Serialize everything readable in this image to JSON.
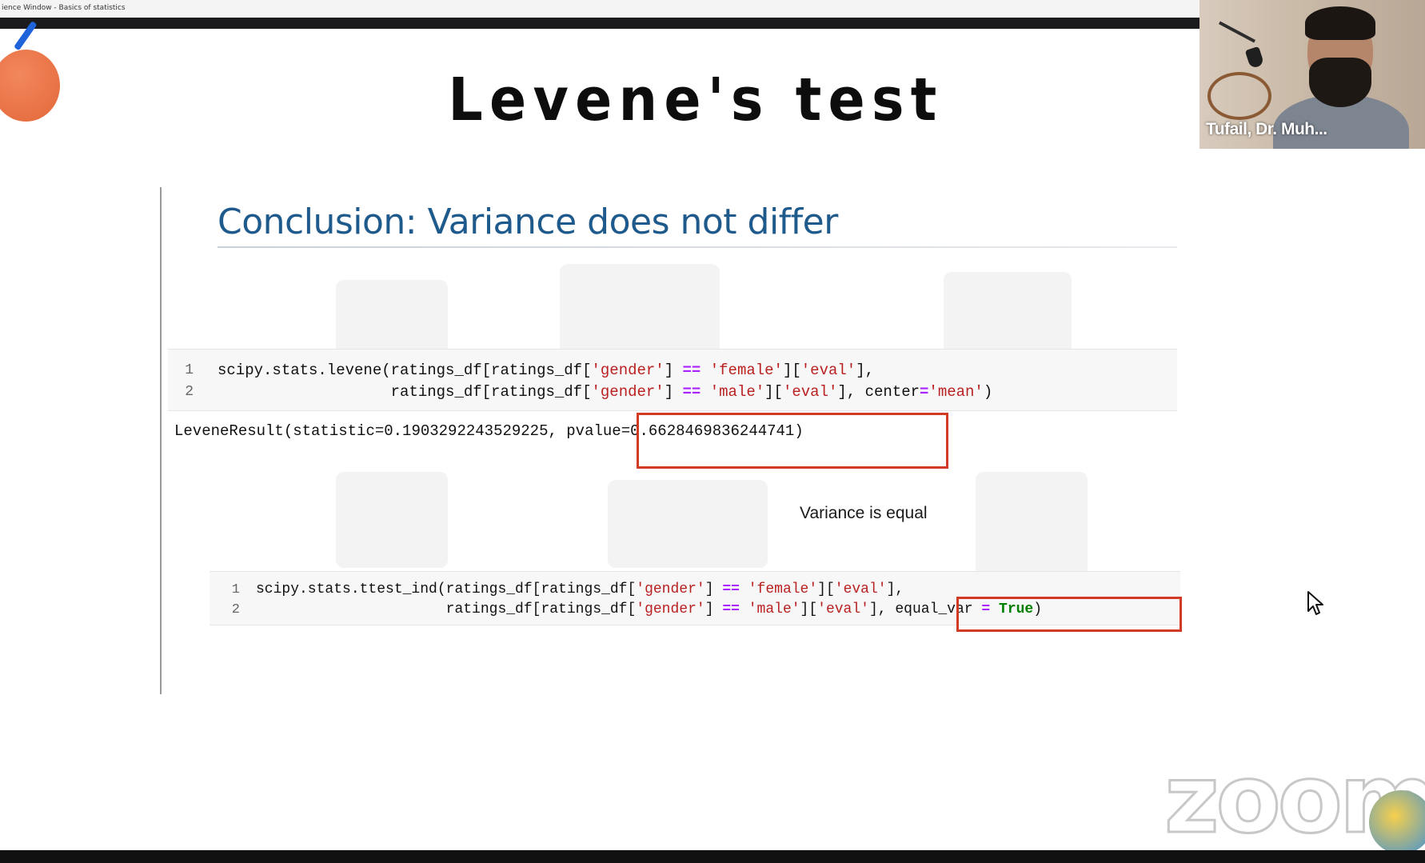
{
  "window": {
    "title": "ience Window - Basics of statistics"
  },
  "slide": {
    "title": "Levene's test",
    "conclusion": "Conclusion: Variance does not differ",
    "note": "Variance is equal"
  },
  "code_block_1": {
    "line_numbers": [
      "1",
      "2"
    ],
    "line1": {
      "a": "scipy.stats.levene(ratings_df[ratings_df[",
      "s1": "'gender'",
      "b": "] ",
      "op": "==",
      "c": " ",
      "s2": "'female'",
      "d": "][",
      "s3": "'eval'",
      "e": "],"
    },
    "line2": {
      "a": "                   ratings_df[ratings_df[",
      "s1": "'gender'",
      "b": "] ",
      "op": "==",
      "c": " ",
      "s2": "'male'",
      "d": "][",
      "s3": "'eval'",
      "e": "], center",
      "op2": "=",
      "s4": "'mean'",
      "f": ")"
    }
  },
  "output": {
    "prefix": "LeveneResult(statistic=0.1903292243529225, ",
    "pvalue": "pvalue=0.6628469836244741)"
  },
  "code_block_2": {
    "line_numbers": [
      "1",
      "2"
    ],
    "line1": {
      "a": "scipy.stats.ttest_ind(ratings_df[ratings_df[",
      "s1": "'gender'",
      "b": "] ",
      "op": "==",
      "c": " ",
      "s2": "'female'",
      "d": "][",
      "s3": "'eval'",
      "e": "],"
    },
    "line2": {
      "a": "                      ratings_df[ratings_df[",
      "s1": "'gender'",
      "b": "] ",
      "op": "==",
      "c": " ",
      "s2": "'male'",
      "d": "][",
      "s3": "'eval'",
      "e": "], ",
      "f": "equal_var ",
      "op2": "=",
      "g": " ",
      "kw": "True",
      "h": ")"
    }
  },
  "video": {
    "participant_name": "Tufail, Dr. Muh..."
  },
  "branding": {
    "logo_text": "zoom"
  },
  "colors": {
    "accent_red": "#d13a24",
    "title_blue": "#1f5a8c",
    "string_red": "#ba2121",
    "operator_purple": "#aa22ff",
    "keyword_green": "#008000"
  }
}
